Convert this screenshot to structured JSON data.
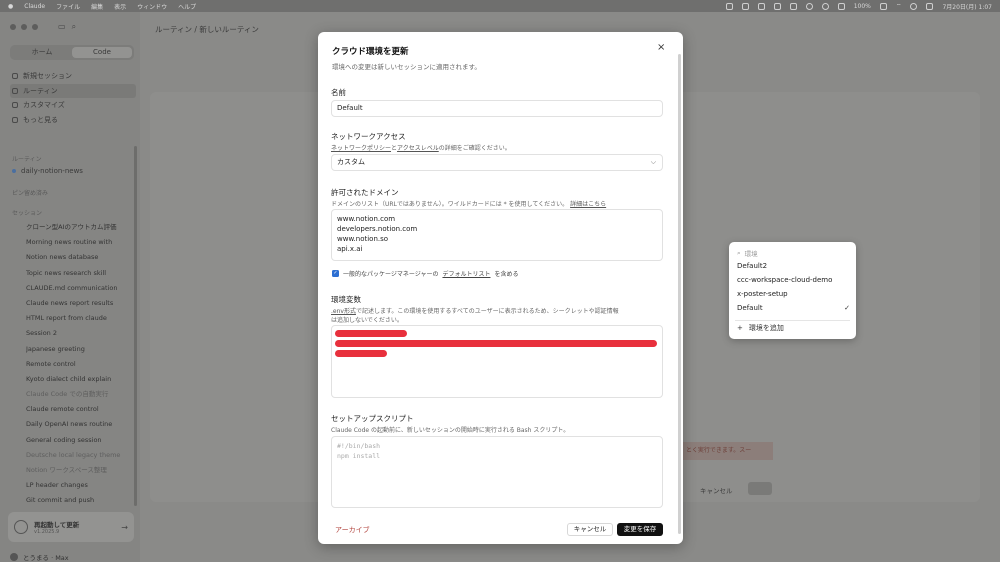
{
  "menubar": {
    "app": "Claude",
    "items": [
      "ファイル",
      "編集",
      "表示",
      "ウィンドウ",
      "ヘルプ"
    ],
    "battery": "100%",
    "datetime": "7月20日(月) 1:07"
  },
  "sidebar": {
    "seg_home": "ホーム",
    "seg_code": "Code",
    "nav": [
      {
        "label": "新規セッション"
      },
      {
        "label": "ルーティン"
      },
      {
        "label": "カスタマイズ"
      },
      {
        "label": "もっと見る"
      }
    ],
    "routines_heading": "ルーティン",
    "routine_item": "daily-notion-news",
    "pinned_heading": "ピン留め済み",
    "sessions_heading": "セッション",
    "sessions": [
      "クローン型AIのアウトカム評価",
      "Morning news routine with",
      "Notion news database",
      "Topic news research skill",
      "CLAUDE.md communication",
      "Claude news report results",
      "HTML report from claude",
      "Session 2",
      "Japanese greeting",
      "Remote control",
      "Kyoto dialect child explain",
      "Claude Code での自動実行",
      "Claude remote control",
      "Daily OpenAI news routine",
      "General coding session",
      "Deutsche local legacy theme",
      "Notion ワークスペース整理",
      "LP header changes",
      "Git commit and push"
    ],
    "update_title": "再起動して更新",
    "update_version": "v1.2025.9",
    "user": "とうまる · Max"
  },
  "main": {
    "breadcrumb": "ルーティン / 新しいルーティン",
    "banner_text": "とく実行できます。スー",
    "cancel": "キャンセル"
  },
  "dropdown": {
    "search_placeholder": "環境",
    "options": [
      {
        "label": "Default2",
        "checked": ""
      },
      {
        "label": "ccc-workspace-cloud-demo",
        "checked": ""
      },
      {
        "label": "x-poster-setup",
        "checked": ""
      },
      {
        "label": "Default",
        "checked": "✓"
      }
    ],
    "add_label": "環境を追加"
  },
  "modal": {
    "title": "クラウド環境を更新",
    "subtitle": "環境への変更は新しいセッションに適用されます。",
    "name_label": "名前",
    "name_value": "Default",
    "network_label": "ネットワークアクセス",
    "network_hint_link1": "ネットワークポリシー",
    "network_hint_mid": "と",
    "network_hint_link2": "アクセスレベル",
    "network_hint_end": "の詳細をご確認ください。",
    "network_value": "カスタム",
    "domains_label": "許可されたドメイン",
    "domains_hint": "ドメインのリスト（URLではありません）。ワイルドカードには * を使用してください。",
    "domains_hint_link": "詳細はこちら",
    "domains": [
      "www.notion.com",
      "developers.notion.com",
      "www.notion.so",
      "api.x.ai"
    ],
    "include_pkg_pre": "一般的なパッケージマネージャーの",
    "include_pkg_link": "デフォルトリスト",
    "include_pkg_post": "を含める",
    "env_label": "環境変数",
    "env_hint_link": ".env形式",
    "env_hint_1": "で記述します。この環境を使用するすべてのユーザーに表示されるため、シークレットや認証情報",
    "env_hint_2": "は追加しないでください。",
    "setup_label": "セットアップスクリプト",
    "setup_hint": "Claude Code の起動前に、新しいセッションの開始時に実行される Bash スクリプト。",
    "setup_placeholder_1": "#!/bin/bash",
    "setup_placeholder_2": "npm install",
    "archive": "アーカイブ",
    "cancel": "キャンセル",
    "save": "変更を保存"
  },
  "colors": {
    "save_bg": "#111111",
    "archive": "#b0403a",
    "redaction": "#e8303c",
    "checkbox": "#2d6fd2"
  }
}
